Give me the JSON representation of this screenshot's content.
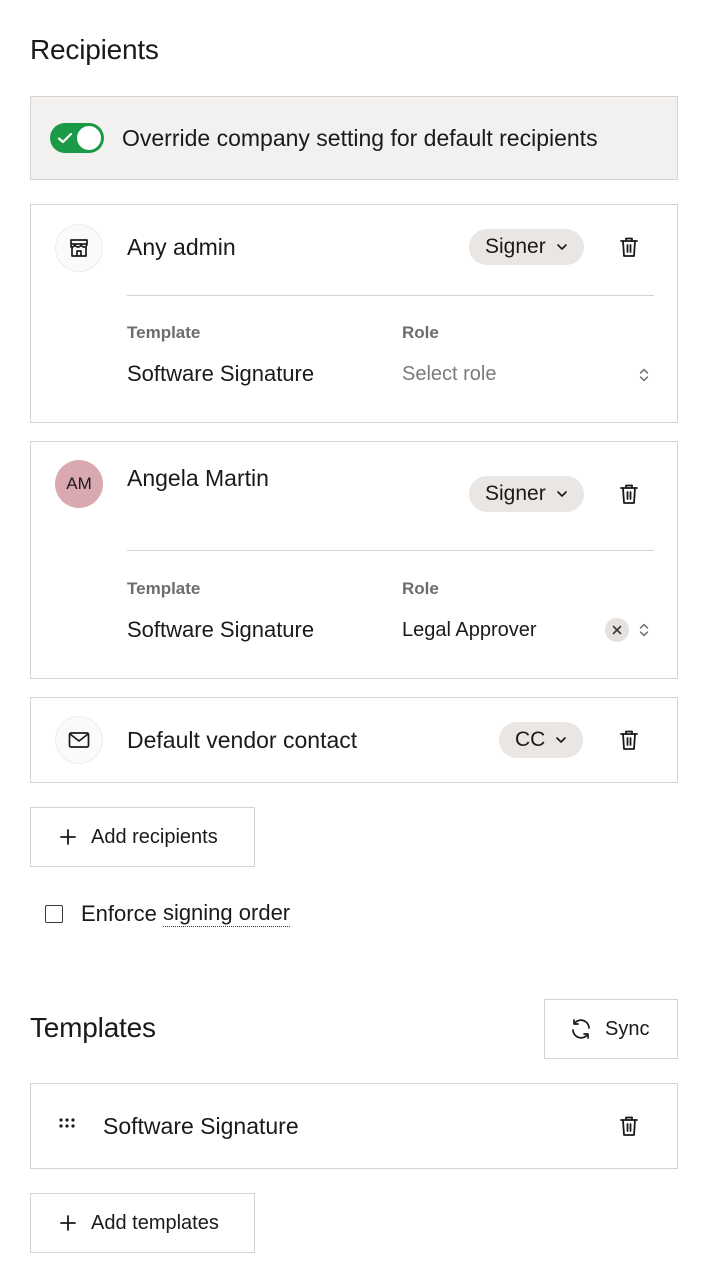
{
  "recipients_section": {
    "title": "Recipients",
    "override_label": "Override company setting for default recipients",
    "override_enabled": true,
    "recipients": [
      {
        "name": "Any admin",
        "avatar_icon": "store-icon",
        "type_label": "Signer",
        "template_label": "Template",
        "template_value": "Software Signature",
        "role_label": "Role",
        "role_placeholder": "Select role"
      },
      {
        "name": "Angela Martin",
        "avatar_initials": "AM",
        "type_label": "Signer",
        "template_label": "Template",
        "template_value": "Software Signature",
        "role_label": "Role",
        "role_value": "Legal Approver"
      },
      {
        "name": "Default vendor contact",
        "avatar_icon": "mail-icon",
        "type_label": "CC"
      }
    ],
    "add_recipients_label": "Add recipients",
    "enforce_prefix": "Enforce ",
    "enforce_link": "signing order",
    "enforce_checked": false
  },
  "templates_section": {
    "title": "Templates",
    "sync_label": "Sync",
    "templates": [
      {
        "name": "Software Signature"
      }
    ],
    "add_templates_label": "Add templates"
  },
  "colors": {
    "toggle_on": "#1a9a47",
    "pill_bg": "#e9e6e3",
    "avatar_am": "#d9a8b0",
    "override_bg": "#f2f1ef",
    "border": "#d6d3cf"
  }
}
